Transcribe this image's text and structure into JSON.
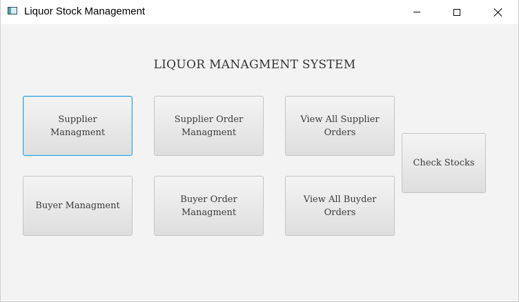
{
  "window": {
    "title": "Liquor Stock Management",
    "controls": {
      "minimize": "minimize-icon",
      "maximize": "maximize-icon",
      "close": "close-icon"
    }
  },
  "main": {
    "heading": "LIQUOR MANAGMENT SYSTEM",
    "buttons": {
      "supplier_managment": "Supplier Managment",
      "supplier_order_managment": "Supplier Order Managment",
      "view_all_supplier_orders": "View All Supplier Orders",
      "check_stocks": "Check Stocks",
      "buyer_managment": "Buyer Managment",
      "buyer_order_managment": "Buyer Order Managment",
      "view_all_buyder_orders": "View All Buyder Orders"
    },
    "focused_button": "supplier_managment"
  },
  "colors": {
    "background": "#f3f3f3",
    "focus_border": "#2f9ad6",
    "button_border": "#c4c4c4",
    "text": "#3a3a3a"
  }
}
